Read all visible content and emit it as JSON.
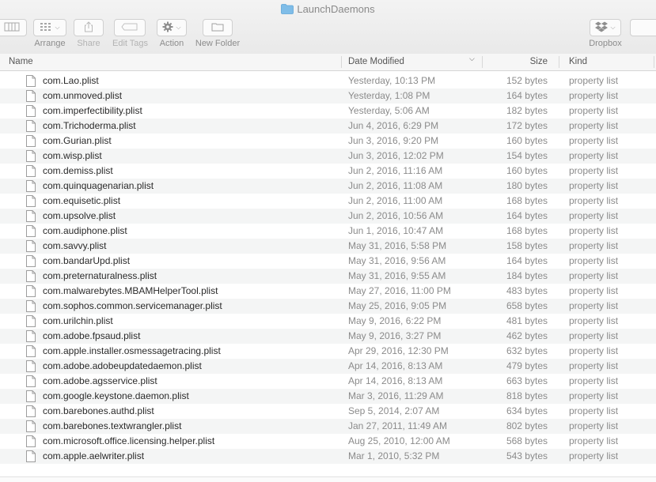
{
  "window": {
    "title": "LaunchDaemons"
  },
  "toolbar": {
    "arrange_label": "Arrange",
    "share_label": "Share",
    "edit_tags_label": "Edit Tags",
    "action_label": "Action",
    "new_folder_label": "New Folder",
    "dropbox_label": "Dropbox"
  },
  "columns": {
    "name": "Name",
    "date": "Date Modified",
    "size": "Size",
    "kind": "Kind"
  },
  "files": [
    {
      "name": "com.Lao.plist",
      "date": "Yesterday, 10:13 PM",
      "size": "152 bytes",
      "kind": "property list"
    },
    {
      "name": "com.unmoved.plist",
      "date": "Yesterday, 1:08 PM",
      "size": "164 bytes",
      "kind": "property list"
    },
    {
      "name": "com.imperfectibility.plist",
      "date": "Yesterday, 5:06 AM",
      "size": "182 bytes",
      "kind": "property list"
    },
    {
      "name": "com.Trichoderma.plist",
      "date": "Jun 4, 2016, 6:29 PM",
      "size": "172 bytes",
      "kind": "property list"
    },
    {
      "name": "com.Gurian.plist",
      "date": "Jun 3, 2016, 9:20 PM",
      "size": "160 bytes",
      "kind": "property list"
    },
    {
      "name": "com.wisp.plist",
      "date": "Jun 3, 2016, 12:02 PM",
      "size": "154 bytes",
      "kind": "property list"
    },
    {
      "name": "com.demiss.plist",
      "date": "Jun 2, 2016, 11:16 AM",
      "size": "160 bytes",
      "kind": "property list"
    },
    {
      "name": "com.quinquagenarian.plist",
      "date": "Jun 2, 2016, 11:08 AM",
      "size": "180 bytes",
      "kind": "property list"
    },
    {
      "name": "com.equisetic.plist",
      "date": "Jun 2, 2016, 11:00 AM",
      "size": "168 bytes",
      "kind": "property list"
    },
    {
      "name": "com.upsolve.plist",
      "date": "Jun 2, 2016, 10:56 AM",
      "size": "164 bytes",
      "kind": "property list"
    },
    {
      "name": "com.audiphone.plist",
      "date": "Jun 1, 2016, 10:47 AM",
      "size": "168 bytes",
      "kind": "property list"
    },
    {
      "name": "com.savvy.plist",
      "date": "May 31, 2016, 5:58 PM",
      "size": "158 bytes",
      "kind": "property list"
    },
    {
      "name": "com.bandarUpd.plist",
      "date": "May 31, 2016, 9:56 AM",
      "size": "164 bytes",
      "kind": "property list"
    },
    {
      "name": "com.preternaturalness.plist",
      "date": "May 31, 2016, 9:55 AM",
      "size": "184 bytes",
      "kind": "property list"
    },
    {
      "name": "com.malwarebytes.MBAMHelperTool.plist",
      "date": "May 27, 2016, 11:00 PM",
      "size": "483 bytes",
      "kind": "property list"
    },
    {
      "name": "com.sophos.common.servicemanager.plist",
      "date": "May 25, 2016, 9:05 PM",
      "size": "658 bytes",
      "kind": "property list"
    },
    {
      "name": "com.urilchin.plist",
      "date": "May 9, 2016, 6:22 PM",
      "size": "481 bytes",
      "kind": "property list"
    },
    {
      "name": "com.adobe.fpsaud.plist",
      "date": "May 9, 2016, 3:27 PM",
      "size": "462 bytes",
      "kind": "property list"
    },
    {
      "name": "com.apple.installer.osmessagetracing.plist",
      "date": "Apr 29, 2016, 12:30 PM",
      "size": "632 bytes",
      "kind": "property list"
    },
    {
      "name": "com.adobe.adobeupdatedaemon.plist",
      "date": "Apr 14, 2016, 8:13 AM",
      "size": "479 bytes",
      "kind": "property list"
    },
    {
      "name": "com.adobe.agsservice.plist",
      "date": "Apr 14, 2016, 8:13 AM",
      "size": "663 bytes",
      "kind": "property list"
    },
    {
      "name": "com.google.keystone.daemon.plist",
      "date": "Mar 3, 2016, 11:29 AM",
      "size": "818 bytes",
      "kind": "property list"
    },
    {
      "name": "com.barebones.authd.plist",
      "date": "Sep 5, 2014, 2:07 AM",
      "size": "634 bytes",
      "kind": "property list"
    },
    {
      "name": "com.barebones.textwrangler.plist",
      "date": "Jan 27, 2011, 11:49 AM",
      "size": "802 bytes",
      "kind": "property list"
    },
    {
      "name": "com.microsoft.office.licensing.helper.plist",
      "date": "Aug 25, 2010, 12:00 AM",
      "size": "568 bytes",
      "kind": "property list"
    },
    {
      "name": "com.apple.aelwriter.plist",
      "date": "Mar 1, 2010, 5:32 PM",
      "size": "543 bytes",
      "kind": "property list"
    }
  ]
}
